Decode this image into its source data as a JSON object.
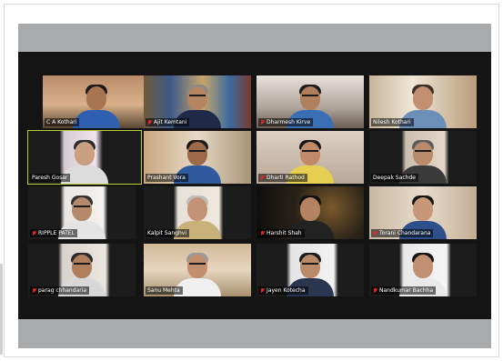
{
  "meeting": {
    "participants": [
      {
        "name": "C A Kothari",
        "muted": false
      },
      {
        "name": "Ajit Kemtani",
        "muted": true
      },
      {
        "name": "Dharmesh Kirve",
        "muted": true
      },
      {
        "name": "Nilesh Kothari",
        "muted": false
      },
      {
        "name": "Paresh Gosar",
        "muted": false
      },
      {
        "name": "Prashant Vora",
        "muted": false
      },
      {
        "name": "Dharti Rathod",
        "muted": true
      },
      {
        "name": "Deepak Sachde",
        "muted": false
      },
      {
        "name": "RIPPLE PATEL",
        "muted": true
      },
      {
        "name": "Kalpit Sanghvi",
        "muted": false
      },
      {
        "name": "Harshit Shah",
        "muted": true
      },
      {
        "name": "Torani Chandarana",
        "muted": true
      },
      {
        "name": "parag chhandaria",
        "muted": true
      },
      {
        "name": "Sanu Mehta",
        "muted": false
      },
      {
        "name": "Jayen Kotecha",
        "muted": true
      },
      {
        "name": "Nandkumar Bachha",
        "muted": true
      }
    ],
    "colors": {
      "active_speaker_border": "#b8cf3a",
      "muted_icon": "#e02828",
      "grid_background": "#141414",
      "bar_background": "#a9aaac"
    }
  }
}
